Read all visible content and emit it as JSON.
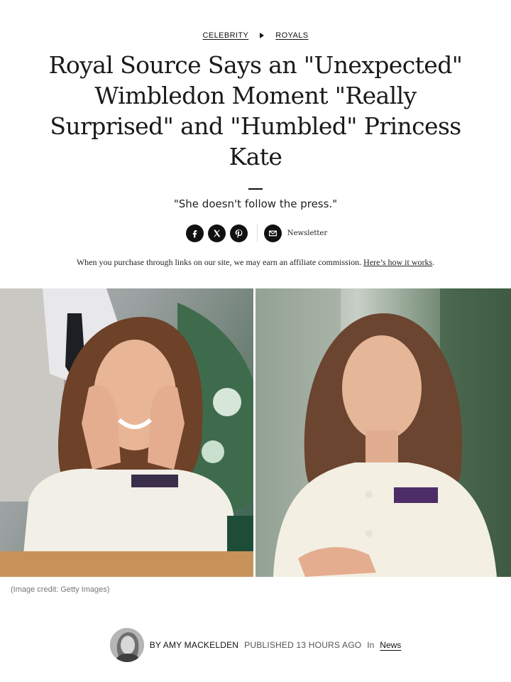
{
  "breadcrumb": {
    "items": [
      "CELEBRITY",
      "ROYALS"
    ]
  },
  "headline": "Royal Source Says an \"Unexpected\" Wimbledon Moment \"Really Surprised\" and \"Humbled\" Princess Kate",
  "standfirst": "\"She doesn't follow the press.\"",
  "share": {
    "icons": [
      "facebook-icon",
      "x-icon",
      "pinterest-icon",
      "mail-icon"
    ],
    "newsletter_label": "Newsletter"
  },
  "affiliate": {
    "text": "When you purchase through links on our site, we may earn an affiliate commission. ",
    "link_text": "Here’s how it works",
    "suffix": "."
  },
  "image": {
    "credit": "(Image credit: Getty Images)"
  },
  "byline": {
    "by": "BY AMY MACKELDEN",
    "published": "PUBLISHED 13 HOURS AGO",
    "in_label": "In",
    "section": "News"
  }
}
